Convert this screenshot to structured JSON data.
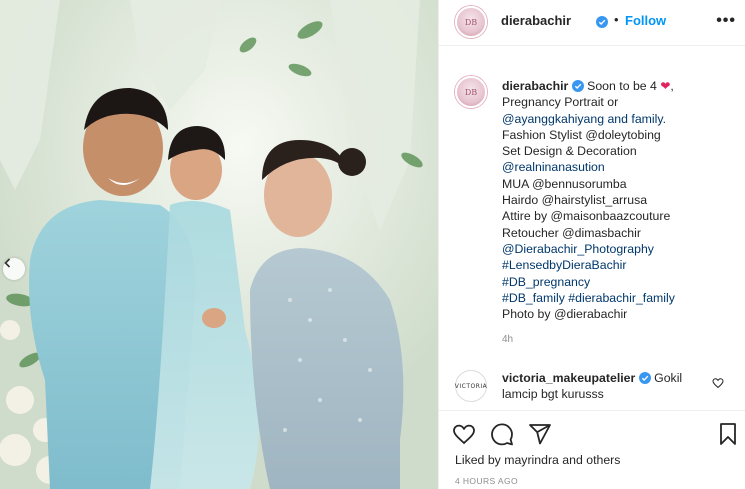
{
  "post": {
    "username": "dierabachir",
    "follow_label": "Follow",
    "separator": "•",
    "more_label": "•••"
  },
  "caption": {
    "username": "dierabachir",
    "lines": [
      {
        "text": "Soon to be 4 ",
        "emoji": "❤",
        "after": ","
      },
      "Pregnancy Portrait or",
      "@ayanggkahiyang and family.",
      "Fashion Stylist @doleytobing",
      "Set Design & Decoration",
      "@realninanasution",
      "MUA @bennusorumba",
      "Hairdo @hairstylist_arrusa",
      "Attire by @maisonbaazcouture",
      "Retoucher @dimasbachir",
      "@Dierabachir_Photography",
      "#LensedbyDieraBachir",
      "#DB_pregnancy",
      "#DB_family #dierabachir_family",
      "Photo by @dierabachir"
    ],
    "time_ago": "4h"
  },
  "comment": {
    "avatar_text": "VICTORIA",
    "username": "victoria_makeupatelier",
    "text": "Gokil lamcip bgt kurusss"
  },
  "actions": {
    "icons": [
      "heart-icon",
      "comment-icon",
      "share-icon",
      "bookmark-icon"
    ],
    "liked_by": "Liked by mayrindra and others",
    "timestamp": "4 HOURS AGO"
  },
  "colors": {
    "link": "#00376b",
    "follow": "#0095f6",
    "verified": "#3897f0",
    "muted": "#8e8e8e"
  }
}
